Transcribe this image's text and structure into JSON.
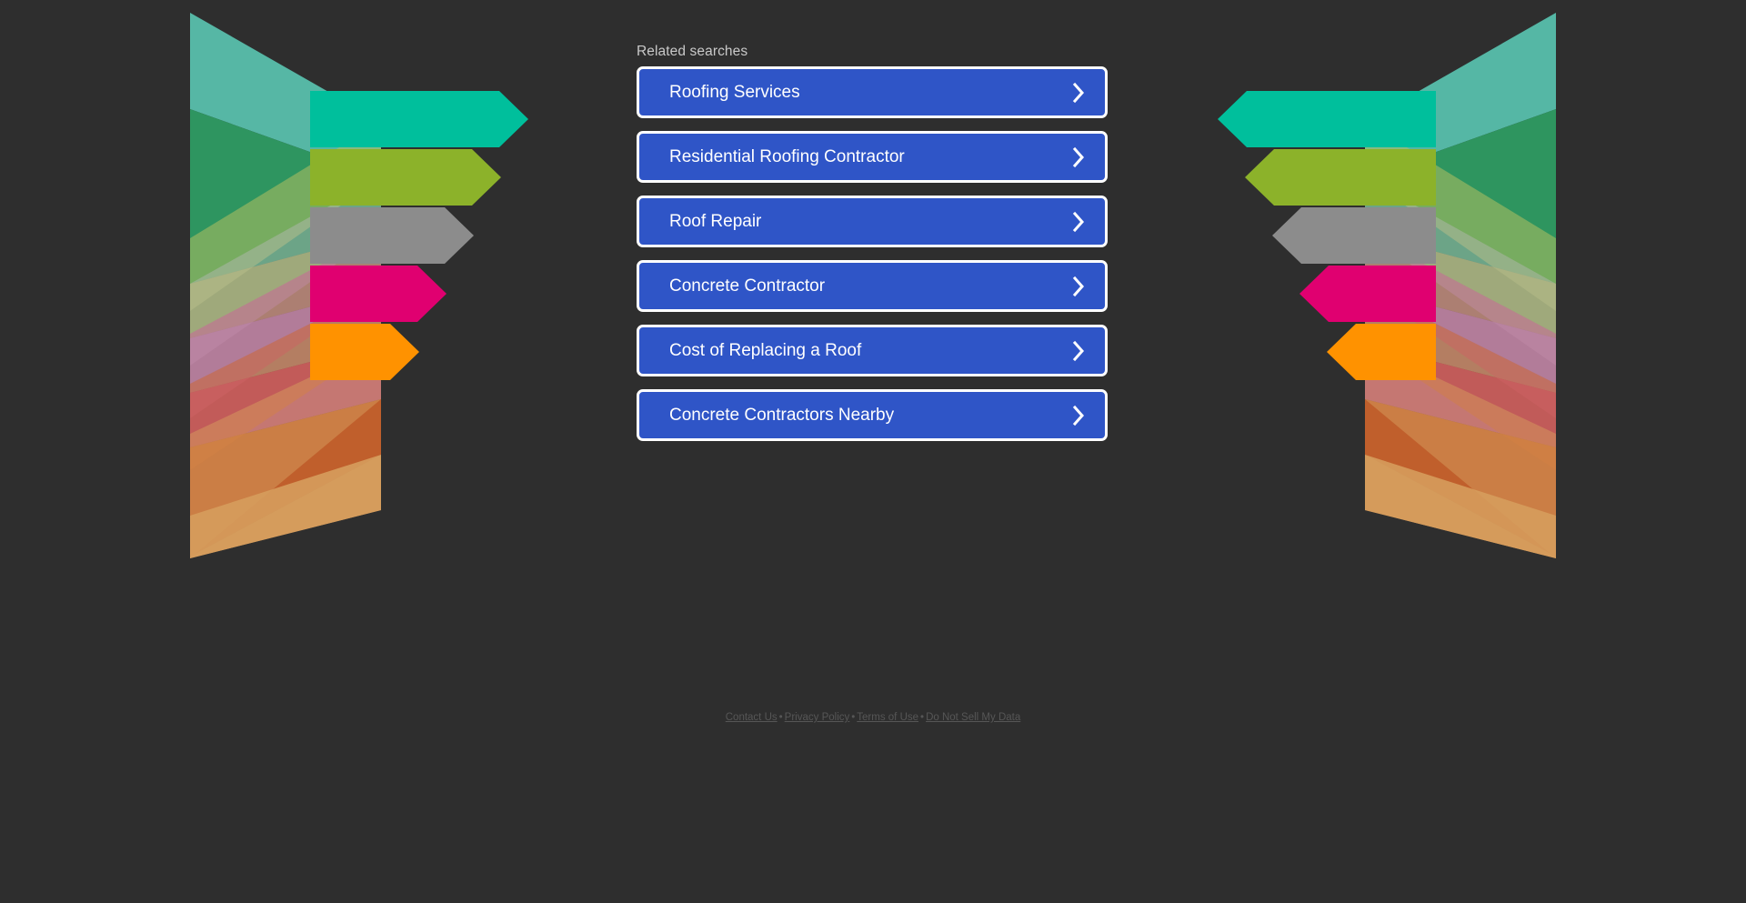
{
  "background_color": "#2e2e2e",
  "related": {
    "label": "Related searches",
    "accent_color": "#2f55c7",
    "border_color": "#ffffff",
    "text_color": "#ffffff",
    "chevron_icon": "chevron-right-icon",
    "items": [
      {
        "label": "Roofing Services"
      },
      {
        "label": "Residential Roofing Contractor"
      },
      {
        "label": "Roof Repair"
      },
      {
        "label": "Concrete Contractor"
      },
      {
        "label": "Cost of Replacing a Roof"
      },
      {
        "label": "Concrete Contractors Nearby"
      }
    ]
  },
  "graphic": {
    "name": "funnel-arrows-decoration",
    "arrow_colors": [
      "#00bf9c",
      "#8cb22a",
      "#8c8c8c",
      "#e00070",
      "#ff9200"
    ],
    "ribbon_colors": [
      "#6fd9bf",
      "#45b97c",
      "#c9d87a",
      "#c2c2c2",
      "#ef7dbb",
      "#f47c3c",
      "#fcb667"
    ]
  },
  "footer": {
    "links": [
      {
        "label": "Contact Us"
      },
      {
        "label": "Privacy Policy"
      },
      {
        "label": "Terms of Use"
      },
      {
        "label": "Do Not Sell My Data"
      }
    ],
    "separator": "•"
  }
}
